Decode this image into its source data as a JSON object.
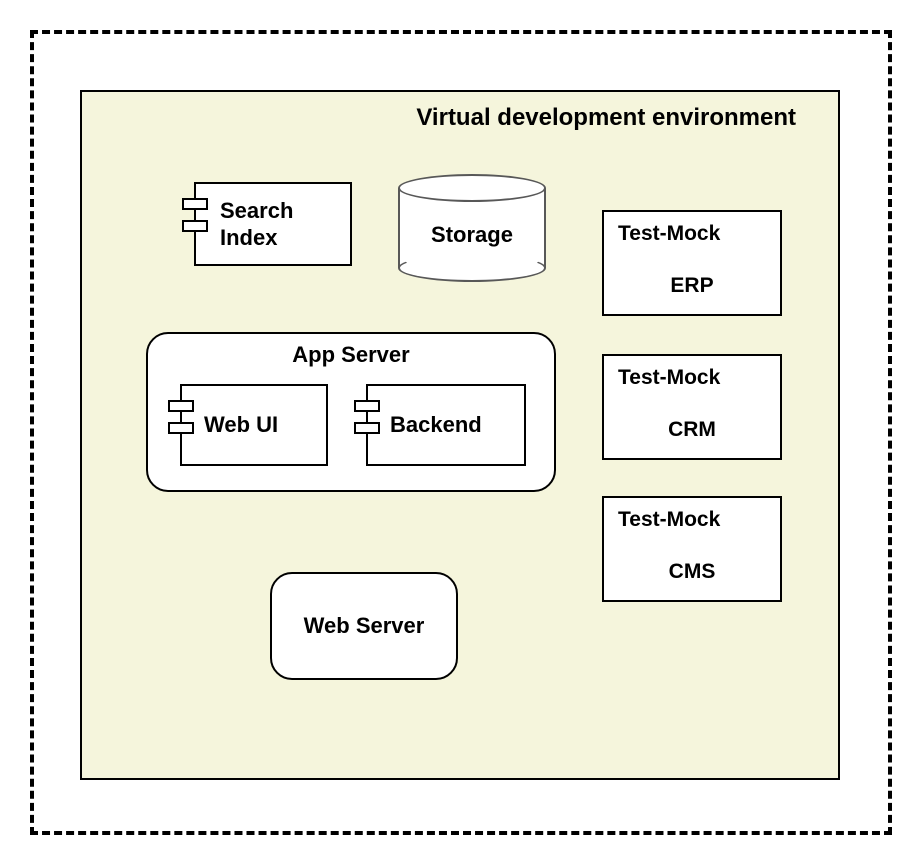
{
  "env": {
    "title": "Virtual  development environment"
  },
  "components": {
    "search_index": "Search\nIndex",
    "storage": "Storage",
    "app_server": "App Server",
    "web_ui": "Web UI",
    "backend": "Backend",
    "web_server": "Web Server"
  },
  "mocks": {
    "erp": {
      "prefix": "Test-Mock",
      "name": "ERP"
    },
    "crm": {
      "prefix": "Test-Mock",
      "name": "CRM"
    },
    "cms": {
      "prefix": "Test-Mock",
      "name": "CMS"
    }
  }
}
